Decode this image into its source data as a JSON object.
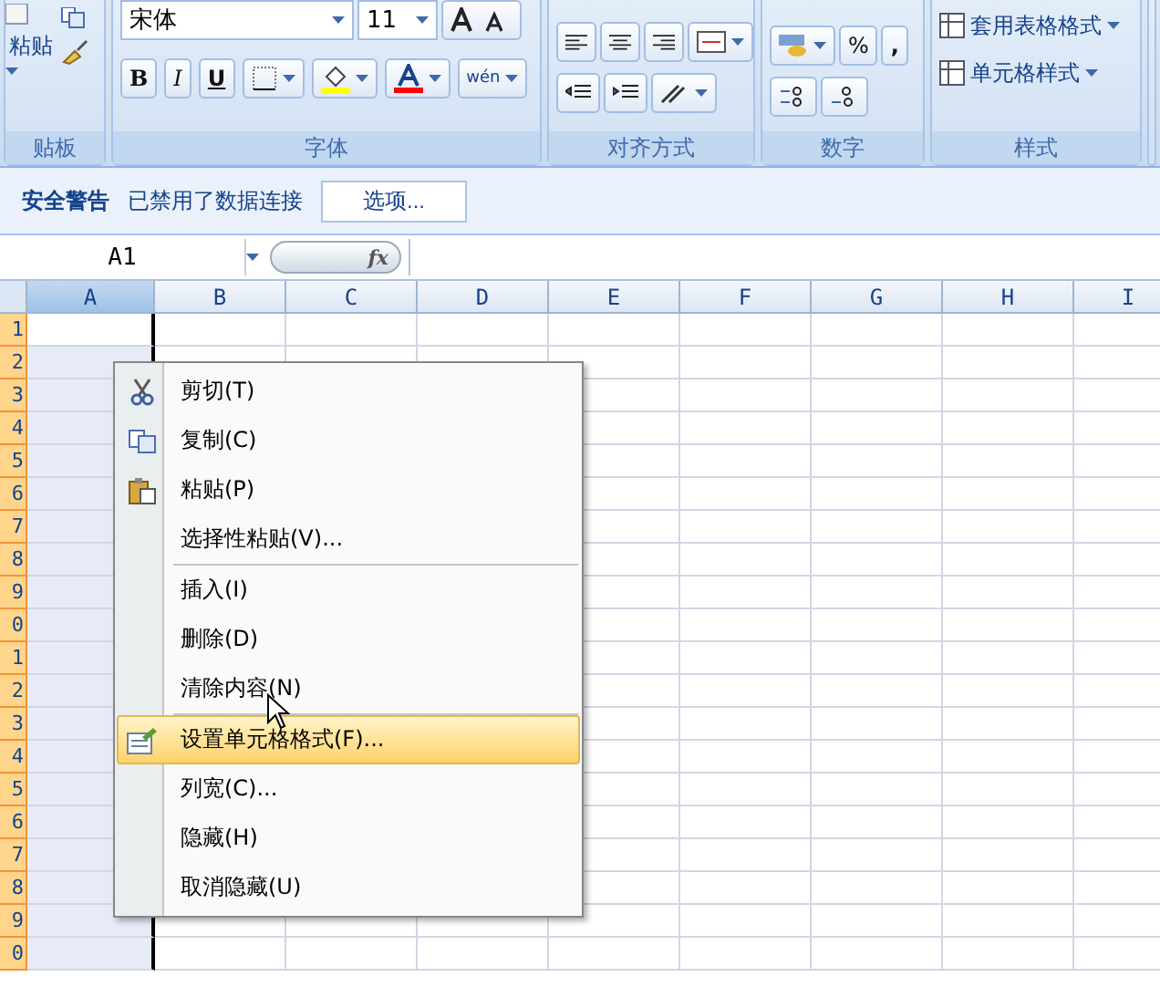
{
  "ribbon": {
    "clipboard": {
      "paste_label": "粘贴",
      "label": "贴板"
    },
    "font": {
      "name": "宋体",
      "size": "11",
      "label": "字体",
      "bold": "B",
      "italic": "I",
      "underline": "U",
      "phonetic": "wén"
    },
    "alignment": {
      "label": "对齐方式"
    },
    "number": {
      "percent": "%",
      "comma": ",",
      "label": "数字"
    },
    "styles": {
      "buttons": [
        "套用表格格式",
        "单元格样式"
      ],
      "label": "样式"
    }
  },
  "security_bar": {
    "title": "安全警告",
    "message": "已禁用了数据连接",
    "button": "选项..."
  },
  "formula_bar": {
    "name_box": "A1",
    "fx": "fx"
  },
  "sheet": {
    "columns": [
      {
        "label": "A",
        "selected": true
      },
      {
        "label": "B",
        "selected": false
      },
      {
        "label": "C",
        "selected": false
      },
      {
        "label": "D",
        "selected": false
      },
      {
        "label": "E",
        "selected": false
      },
      {
        "label": "F",
        "selected": false
      },
      {
        "label": "G",
        "selected": false
      },
      {
        "label": "H",
        "selected": false
      },
      {
        "label": "I",
        "selected": false
      }
    ],
    "rows": [
      "1",
      "2",
      "3",
      "4",
      "5",
      "6",
      "7",
      "8",
      "9",
      "0",
      "1",
      "2",
      "3",
      "4",
      "5",
      "6",
      "7",
      "8",
      "9",
      "0"
    ]
  },
  "context_menu": [
    {
      "kind": "item",
      "label": "剪切(T)",
      "selected": false
    },
    {
      "kind": "item",
      "label": "复制(C)",
      "selected": false
    },
    {
      "kind": "item",
      "label": "粘贴(P)",
      "selected": false
    },
    {
      "kind": "item",
      "label": "选择性粘贴(V)...",
      "selected": false
    },
    {
      "kind": "separator"
    },
    {
      "kind": "item",
      "label": "插入(I)",
      "selected": false
    },
    {
      "kind": "item",
      "label": "删除(D)",
      "selected": false
    },
    {
      "kind": "item",
      "label": "清除内容(N)",
      "selected": false
    },
    {
      "kind": "separator"
    },
    {
      "kind": "item",
      "label": "设置单元格格式(F)...",
      "selected": true
    },
    {
      "kind": "item",
      "label": "列宽(C)...",
      "selected": false
    },
    {
      "kind": "item",
      "label": "隐藏(H)",
      "selected": false
    },
    {
      "kind": "item",
      "label": "取消隐藏(U)",
      "selected": false
    }
  ]
}
